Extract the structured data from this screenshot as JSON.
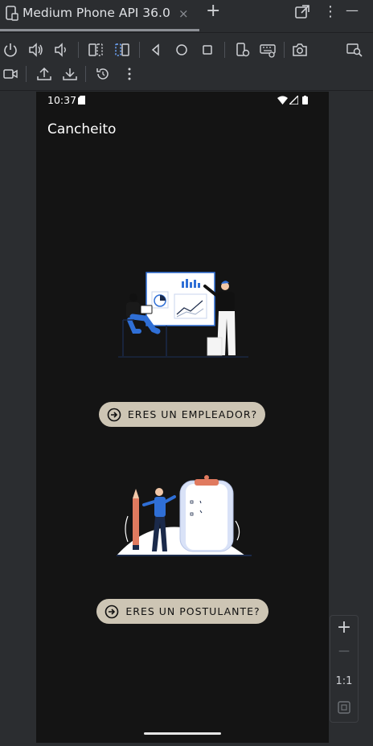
{
  "window": {
    "tab_title": "Medium Phone API 36.0",
    "close_glyph": "×",
    "add_glyph": "+",
    "minimize_glyph": "—",
    "more_glyph": "⋮"
  },
  "toolbar": {
    "row1_icons": [
      "power-icon",
      "volume-up-icon",
      "volume-down-icon",
      "rotate-left-icon",
      "rotate-right-icon",
      "back-icon",
      "home-icon",
      "overview-icon",
      "device-settings-icon",
      "keyboard-icon",
      "camera-icon",
      "zoom-screen-icon"
    ],
    "row2_icons": [
      "record-video-icon",
      "upload-icon",
      "download-icon",
      "reset-icon",
      "more-icon"
    ]
  },
  "zoom_controls": {
    "zoom_in": "+",
    "zoom_out": "—",
    "one_to_one": "1:1"
  },
  "phone": {
    "status": {
      "time": "10:37"
    },
    "app_title": "Cancheito",
    "buttons": [
      {
        "label": "ERES UN EMPLEADOR?"
      },
      {
        "label": "ERES UN POSTULANTE?"
      }
    ]
  },
  "colors": {
    "app_background": "#141414",
    "pill_background": "#cdc5b4",
    "ide_background": "#2b2d30",
    "illustration_accent": "#2f6fd6"
  }
}
